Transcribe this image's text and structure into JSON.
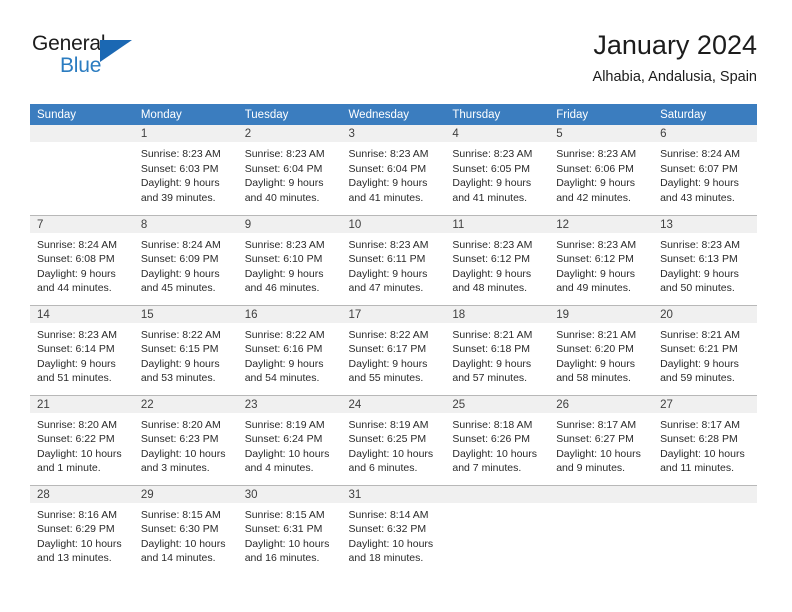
{
  "brand": {
    "name_top": "General",
    "name_bottom": "Blue",
    "triangle_color": "#1b68b3",
    "blue_text_color": "#2b7cc0"
  },
  "header": {
    "title": "January 2024",
    "subtitle": "Alhabia, Andalusia, Spain",
    "header_bg_color": "#3b7dbf"
  },
  "weekday_headers": [
    "Sunday",
    "Monday",
    "Tuesday",
    "Wednesday",
    "Thursday",
    "Friday",
    "Saturday"
  ],
  "weeks": [
    [
      {
        "day": "",
        "lines": []
      },
      {
        "day": "1",
        "lines": [
          "Sunrise: 8:23 AM",
          "Sunset: 6:03 PM",
          "Daylight: 9 hours",
          "and 39 minutes."
        ]
      },
      {
        "day": "2",
        "lines": [
          "Sunrise: 8:23 AM",
          "Sunset: 6:04 PM",
          "Daylight: 9 hours",
          "and 40 minutes."
        ]
      },
      {
        "day": "3",
        "lines": [
          "Sunrise: 8:23 AM",
          "Sunset: 6:04 PM",
          "Daylight: 9 hours",
          "and 41 minutes."
        ]
      },
      {
        "day": "4",
        "lines": [
          "Sunrise: 8:23 AM",
          "Sunset: 6:05 PM",
          "Daylight: 9 hours",
          "and 41 minutes."
        ]
      },
      {
        "day": "5",
        "lines": [
          "Sunrise: 8:23 AM",
          "Sunset: 6:06 PM",
          "Daylight: 9 hours",
          "and 42 minutes."
        ]
      },
      {
        "day": "6",
        "lines": [
          "Sunrise: 8:24 AM",
          "Sunset: 6:07 PM",
          "Daylight: 9 hours",
          "and 43 minutes."
        ]
      }
    ],
    [
      {
        "day": "7",
        "lines": [
          "Sunrise: 8:24 AM",
          "Sunset: 6:08 PM",
          "Daylight: 9 hours",
          "and 44 minutes."
        ]
      },
      {
        "day": "8",
        "lines": [
          "Sunrise: 8:24 AM",
          "Sunset: 6:09 PM",
          "Daylight: 9 hours",
          "and 45 minutes."
        ]
      },
      {
        "day": "9",
        "lines": [
          "Sunrise: 8:23 AM",
          "Sunset: 6:10 PM",
          "Daylight: 9 hours",
          "and 46 minutes."
        ]
      },
      {
        "day": "10",
        "lines": [
          "Sunrise: 8:23 AM",
          "Sunset: 6:11 PM",
          "Daylight: 9 hours",
          "and 47 minutes."
        ]
      },
      {
        "day": "11",
        "lines": [
          "Sunrise: 8:23 AM",
          "Sunset: 6:12 PM",
          "Daylight: 9 hours",
          "and 48 minutes."
        ]
      },
      {
        "day": "12",
        "lines": [
          "Sunrise: 8:23 AM",
          "Sunset: 6:12 PM",
          "Daylight: 9 hours",
          "and 49 minutes."
        ]
      },
      {
        "day": "13",
        "lines": [
          "Sunrise: 8:23 AM",
          "Sunset: 6:13 PM",
          "Daylight: 9 hours",
          "and 50 minutes."
        ]
      }
    ],
    [
      {
        "day": "14",
        "lines": [
          "Sunrise: 8:23 AM",
          "Sunset: 6:14 PM",
          "Daylight: 9 hours",
          "and 51 minutes."
        ]
      },
      {
        "day": "15",
        "lines": [
          "Sunrise: 8:22 AM",
          "Sunset: 6:15 PM",
          "Daylight: 9 hours",
          "and 53 minutes."
        ]
      },
      {
        "day": "16",
        "lines": [
          "Sunrise: 8:22 AM",
          "Sunset: 6:16 PM",
          "Daylight: 9 hours",
          "and 54 minutes."
        ]
      },
      {
        "day": "17",
        "lines": [
          "Sunrise: 8:22 AM",
          "Sunset: 6:17 PM",
          "Daylight: 9 hours",
          "and 55 minutes."
        ]
      },
      {
        "day": "18",
        "lines": [
          "Sunrise: 8:21 AM",
          "Sunset: 6:18 PM",
          "Daylight: 9 hours",
          "and 57 minutes."
        ]
      },
      {
        "day": "19",
        "lines": [
          "Sunrise: 8:21 AM",
          "Sunset: 6:20 PM",
          "Daylight: 9 hours",
          "and 58 minutes."
        ]
      },
      {
        "day": "20",
        "lines": [
          "Sunrise: 8:21 AM",
          "Sunset: 6:21 PM",
          "Daylight: 9 hours",
          "and 59 minutes."
        ]
      }
    ],
    [
      {
        "day": "21",
        "lines": [
          "Sunrise: 8:20 AM",
          "Sunset: 6:22 PM",
          "Daylight: 10 hours",
          "and 1 minute."
        ]
      },
      {
        "day": "22",
        "lines": [
          "Sunrise: 8:20 AM",
          "Sunset: 6:23 PM",
          "Daylight: 10 hours",
          "and 3 minutes."
        ]
      },
      {
        "day": "23",
        "lines": [
          "Sunrise: 8:19 AM",
          "Sunset: 6:24 PM",
          "Daylight: 10 hours",
          "and 4 minutes."
        ]
      },
      {
        "day": "24",
        "lines": [
          "Sunrise: 8:19 AM",
          "Sunset: 6:25 PM",
          "Daylight: 10 hours",
          "and 6 minutes."
        ]
      },
      {
        "day": "25",
        "lines": [
          "Sunrise: 8:18 AM",
          "Sunset: 6:26 PM",
          "Daylight: 10 hours",
          "and 7 minutes."
        ]
      },
      {
        "day": "26",
        "lines": [
          "Sunrise: 8:17 AM",
          "Sunset: 6:27 PM",
          "Daylight: 10 hours",
          "and 9 minutes."
        ]
      },
      {
        "day": "27",
        "lines": [
          "Sunrise: 8:17 AM",
          "Sunset: 6:28 PM",
          "Daylight: 10 hours",
          "and 11 minutes."
        ]
      }
    ],
    [
      {
        "day": "28",
        "lines": [
          "Sunrise: 8:16 AM",
          "Sunset: 6:29 PM",
          "Daylight: 10 hours",
          "and 13 minutes."
        ]
      },
      {
        "day": "29",
        "lines": [
          "Sunrise: 8:15 AM",
          "Sunset: 6:30 PM",
          "Daylight: 10 hours",
          "and 14 minutes."
        ]
      },
      {
        "day": "30",
        "lines": [
          "Sunrise: 8:15 AM",
          "Sunset: 6:31 PM",
          "Daylight: 10 hours",
          "and 16 minutes."
        ]
      },
      {
        "day": "31",
        "lines": [
          "Sunrise: 8:14 AM",
          "Sunset: 6:32 PM",
          "Daylight: 10 hours",
          "and 18 minutes."
        ]
      },
      {
        "day": "",
        "lines": []
      },
      {
        "day": "",
        "lines": []
      },
      {
        "day": "",
        "lines": []
      }
    ]
  ]
}
